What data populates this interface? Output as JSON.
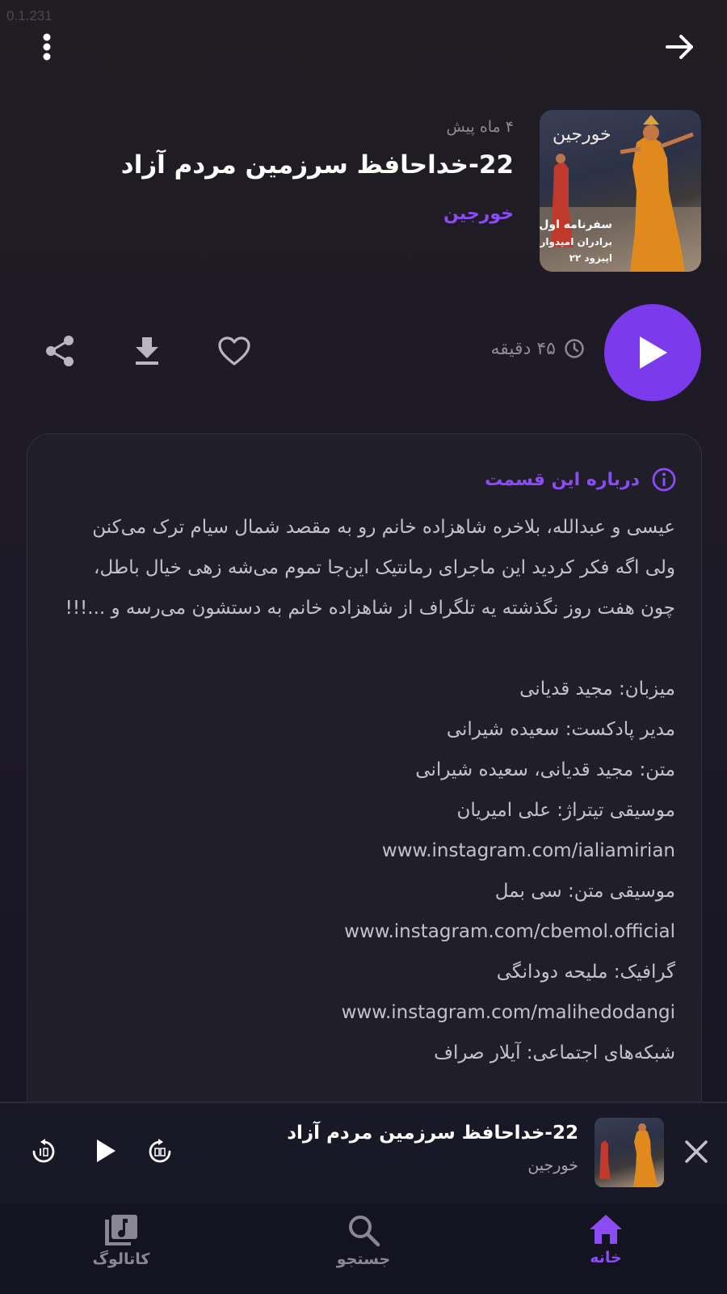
{
  "app": {
    "version": "0.1.231"
  },
  "colors": {
    "accent": "#7c3aed",
    "accent_text": "#8b4cf6",
    "background": "#1b1823",
    "card": "#201e29"
  },
  "icons": {
    "menu": "more-vert-icon",
    "back": "arrow-right-icon",
    "play": "play-icon",
    "clock": "clock-icon",
    "like": "heart-icon",
    "download": "download-icon",
    "share": "share-icon",
    "info": "info-icon",
    "close": "close-icon",
    "forward": "forward-30-icon",
    "rewind": "rewind-10-icon",
    "home": "home-icon",
    "search": "search-icon",
    "catalog": "library-music-icon"
  },
  "episode": {
    "time_ago": "۴ ماه پیش",
    "title": "22-خداحافظ سرزمین مردم آزاد",
    "podcast": "خورجین",
    "duration": "۴۵ دقیقه",
    "cover": {
      "brand": "خورجین",
      "line1": "سفرنامه اول",
      "line2": "برادران امیدوار",
      "line3": "اپیزود ۲۲"
    }
  },
  "about": {
    "label": "درباره این قسمت",
    "description": "عیسی و عبدالله، بلاخره شاهزاده خانم رو به مقصد شمال سیام ترک می‌کنن ولی اگه فکر کردید این ماجرای رمانتیک این‌جا تموم می‌شه زهی خیال باطل، چون هفت روز نگذشته یه تلگراف از شاهزاده خانم به دستشون می‌رسه و ...!!!\n\nمیزبان: مجید قدیانی\nمدیر پادکست: سعیده شیرانی\nمتن: مجید قدیانی، سعیده شیرانی\nموسیقی تیتراژ: علی امیریان\nwww.instagram.com/ialiamirian\nموسیقی متن: سی بمل\nwww.instagram.com/cbemol.official\nگرافیک: ملیحه دودانگی\nwww.instagram.com/malihedodangi\nشبکه‌های اجتماعی: آیلار صراف"
  },
  "mini_player": {
    "title": "22-خداحافظ سرزمین مردم آزاد",
    "podcast": "خورجین"
  },
  "nav": {
    "home": "خانه",
    "search": "جستجو",
    "catalog": "کاتالوگ"
  }
}
